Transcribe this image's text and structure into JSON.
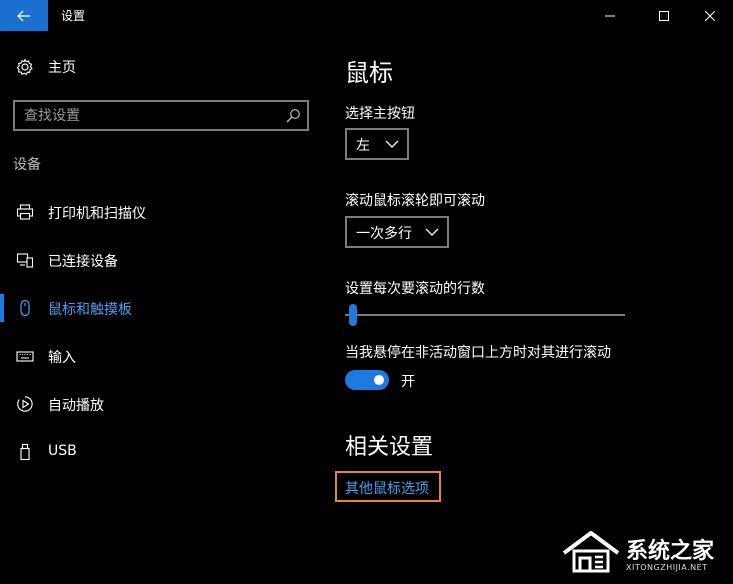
{
  "window": {
    "title": "设置",
    "back_icon": "arrow-left-icon",
    "minimize_icon": "minimize-icon",
    "maximize_icon": "maximize-icon",
    "close_icon": "close-icon",
    "back_button_color": "#1a6fcf"
  },
  "sidebar": {
    "home": {
      "label": "主页",
      "icon": "gear-icon"
    },
    "search": {
      "placeholder": "查找设置",
      "icon": "search-icon"
    },
    "section": "设备",
    "items": [
      {
        "label": "打印机和扫描仪",
        "icon": "printer-icon",
        "active": false
      },
      {
        "label": "已连接设备",
        "icon": "connected-devices-icon",
        "active": false
      },
      {
        "label": "鼠标和触摸板",
        "icon": "mouse-icon",
        "active": true
      },
      {
        "label": "输入",
        "icon": "keyboard-icon",
        "active": false
      },
      {
        "label": "自动播放",
        "icon": "autoplay-icon",
        "active": false
      },
      {
        "label": "USB",
        "icon": "usb-icon",
        "active": false
      }
    ]
  },
  "main": {
    "title": "鼠标",
    "primary_button": {
      "label": "选择主按钮",
      "value": "左"
    },
    "scroll_wheel": {
      "label": "滚动鼠标滚轮即可滚动",
      "value": "一次多行"
    },
    "lines_to_scroll": {
      "label": "设置每次要滚动的行数",
      "slider_fraction": 0.02
    },
    "inactive_scroll": {
      "label": "当我悬停在非活动窗口上方时对其进行滚动",
      "toggle_on": true,
      "toggle_label": "开"
    },
    "related_title": "相关设置",
    "related_link": "其他鼠标选项"
  },
  "colors": {
    "accent": "#1f7ae0",
    "link": "#4a9df0",
    "highlight_box": "#e8823c"
  },
  "watermark": {
    "name": "系统之家",
    "url": "XITONGZHIJIA.NET"
  }
}
